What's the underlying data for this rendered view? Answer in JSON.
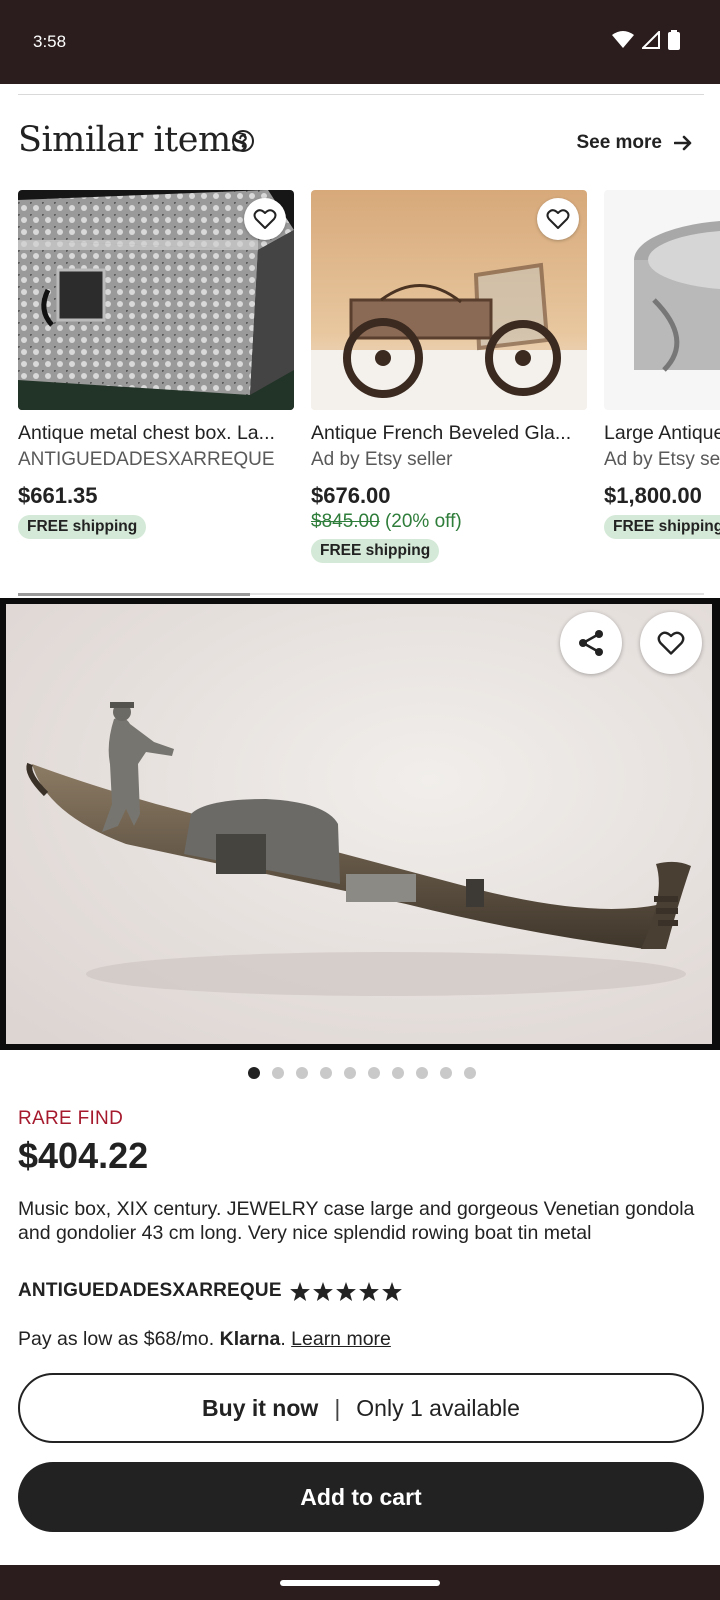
{
  "status_bar": {
    "time": "3:58",
    "icons": [
      "wifi-icon",
      "signal-icon",
      "battery-icon"
    ]
  },
  "similar": {
    "title": "Similar items",
    "see_more": "See more",
    "items": [
      {
        "title": "Antique metal chest box. La...",
        "shop": "ANTIGUEDADESXARREQUE",
        "price": "$661.35",
        "original_price": "",
        "discount": "",
        "shipping": "FREE shipping"
      },
      {
        "title": "Antique French Beveled Gla...",
        "shop": "Ad by Etsy seller",
        "price": "$676.00",
        "original_price": "$845.00",
        "discount": "(20% off)",
        "shipping": "FREE shipping"
      },
      {
        "title": "Large Antique",
        "shop": "Ad by Etsy seller",
        "price": "$1,800.00",
        "original_price": "",
        "discount": "",
        "shipping": "FREE shipping"
      }
    ]
  },
  "listing": {
    "image_count": 10,
    "active_image": 1,
    "badge": "RARE FIND",
    "price": "$404.22",
    "description": "Music box, XIX century. JEWELRY case large and gorgeous Venetian gondola and gondolier 43 cm long. Very nice splendid rowing boat tin metal",
    "shop_name": "ANTIGUEDADESXARREQUE",
    "rating_stars": 5,
    "klarna_prefix": "Pay as low as $68/mo.",
    "klarna_brand": "Klarna",
    "klarna_link": "Learn more",
    "buy_now_label": "Buy it now",
    "buy_now_separator": "|",
    "availability": "Only 1 available",
    "add_to_cart_label": "Add to cart"
  },
  "colors": {
    "status_bar": "#2b1d1d",
    "rare_find": "#a61a2e",
    "discount_green": "#2f7d3a",
    "shipping_badge": "#d4e9d7",
    "primary_button": "#222222"
  }
}
